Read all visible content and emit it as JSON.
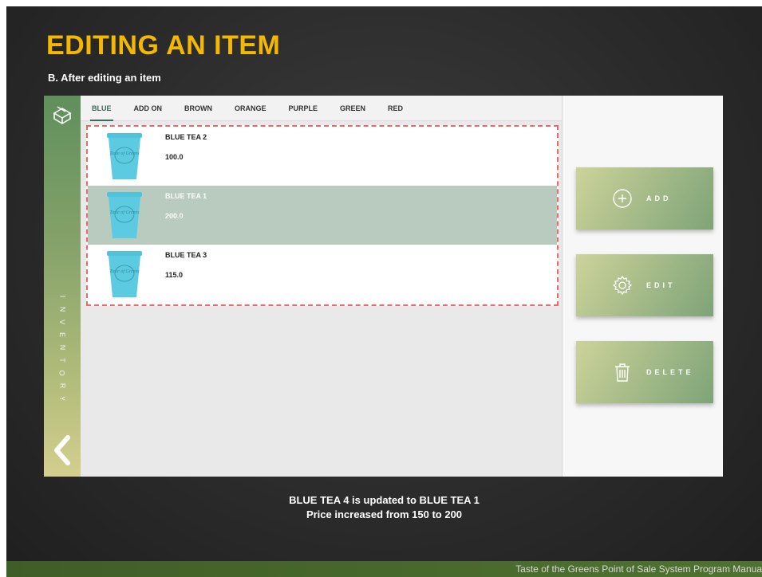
{
  "slide": {
    "title": "EDITING AN ITEM",
    "subtitle": "B. After editing an item",
    "caption_line1": "BLUE TEA 4 is updated to BLUE TEA 1",
    "caption_line2": "Price increased from 150 to 200",
    "footer": "Taste of the Greens Point of Sale System Program Manua"
  },
  "app": {
    "side_label": [
      "I",
      "N",
      "V",
      "E",
      "N",
      "T",
      "O",
      "R",
      "Y"
    ],
    "tabs": [
      {
        "label": "BLUE",
        "active": true
      },
      {
        "label": "ADD ON",
        "active": false
      },
      {
        "label": "BROWN",
        "active": false
      },
      {
        "label": "ORANGE",
        "active": false
      },
      {
        "label": "PURPLE",
        "active": false
      },
      {
        "label": "GREEN",
        "active": false
      },
      {
        "label": "RED",
        "active": false
      }
    ],
    "items": [
      {
        "name": "BLUE TEA 2",
        "price": "100.0",
        "selected": false,
        "cup_text": "Taste of Greens"
      },
      {
        "name": "BLUE TEA 1",
        "price": "200.0",
        "selected": true,
        "cup_text": "Taste of Greens"
      },
      {
        "name": "BLUE TEA 3",
        "price": "115.0",
        "selected": false,
        "cup_text": "Taste of Greens"
      }
    ],
    "actions": {
      "add": {
        "label": "ADD",
        "icon": "plus-circle-icon"
      },
      "edit": {
        "label": "EDIT",
        "icon": "gear-icon"
      },
      "delete": {
        "label": "DELETE",
        "icon": "trash-icon"
      }
    }
  },
  "colors": {
    "title": "#f5b800",
    "accent_green": "#3a6b57",
    "selected_row": "#b9cbbe",
    "dashed_border": "#e86b6b"
  }
}
